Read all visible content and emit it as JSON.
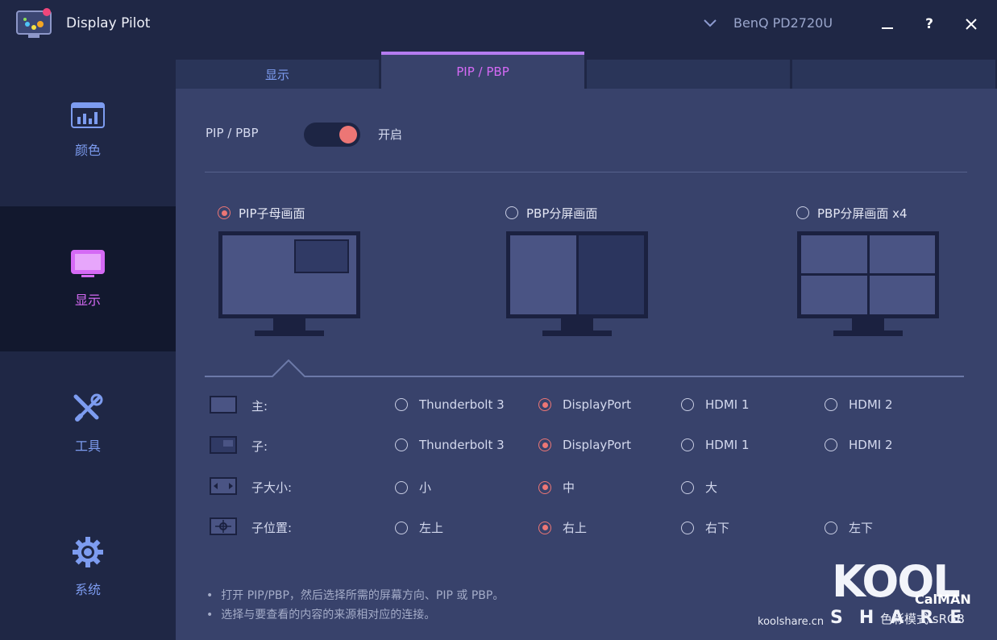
{
  "app": {
    "title": "Display Pilot",
    "monitor": "BenQ PD2720U",
    "window_buttons": {
      "minimize": "—",
      "help": "?",
      "close": "✕"
    }
  },
  "sidebar": {
    "items": [
      {
        "label": "颜色",
        "icon": "bar-chart-icon",
        "active": false
      },
      {
        "label": "显示",
        "icon": "monitor-icon",
        "active": true
      },
      {
        "label": "工具",
        "icon": "tools-icon",
        "active": false
      },
      {
        "label": "系统",
        "icon": "gear-icon",
        "active": false
      }
    ]
  },
  "tabs": [
    {
      "label": "显示",
      "active": false
    },
    {
      "label": "PIP / PBP",
      "active": true
    },
    {
      "label": "",
      "active": false
    },
    {
      "label": "",
      "active": false
    }
  ],
  "pip": {
    "toggle_label": "PIP / PBP",
    "toggle_state": "开启",
    "toggle_on": true
  },
  "modes": [
    {
      "label": "PIP子母画面",
      "selected": true
    },
    {
      "label": "PBP分屏画面",
      "selected": false
    },
    {
      "label": "PBP分屏画面 x4",
      "selected": false
    }
  ],
  "rows": [
    {
      "label": "主:",
      "icon": "main-screen-icon",
      "options": [
        "Thunderbolt 3",
        "DisplayPort",
        "HDMI 1",
        "HDMI 2"
      ],
      "selected": 1
    },
    {
      "label": "子:",
      "icon": "sub-screen-icon",
      "options": [
        "Thunderbolt 3",
        "DisplayPort",
        "HDMI 1",
        "HDMI 2"
      ],
      "selected": 1
    },
    {
      "label": "子大小:",
      "icon": "sub-size-icon",
      "options": [
        "小",
        "中",
        "大"
      ],
      "selected": 1
    },
    {
      "label": "子位置:",
      "icon": "sub-position-icon",
      "options": [
        "左上",
        "右上",
        "右下",
        "左下"
      ],
      "selected": 1
    }
  ],
  "notes": [
    "打开 PIP/PBP，然后选择所需的屏幕方向、PIP 或 PBP。",
    "选择与要查看的内容的来源相对应的连接。"
  ],
  "watermark": {
    "brand": "KOOL",
    "share": "SHARE",
    "site": "koolshare.cn",
    "calman": "CalMAN",
    "mode": "色彩模式 sRGB"
  },
  "colors": {
    "accent": "#d56af5",
    "radio": "#ec7675",
    "link": "#7d9cf0",
    "panel": "#38426b"
  }
}
